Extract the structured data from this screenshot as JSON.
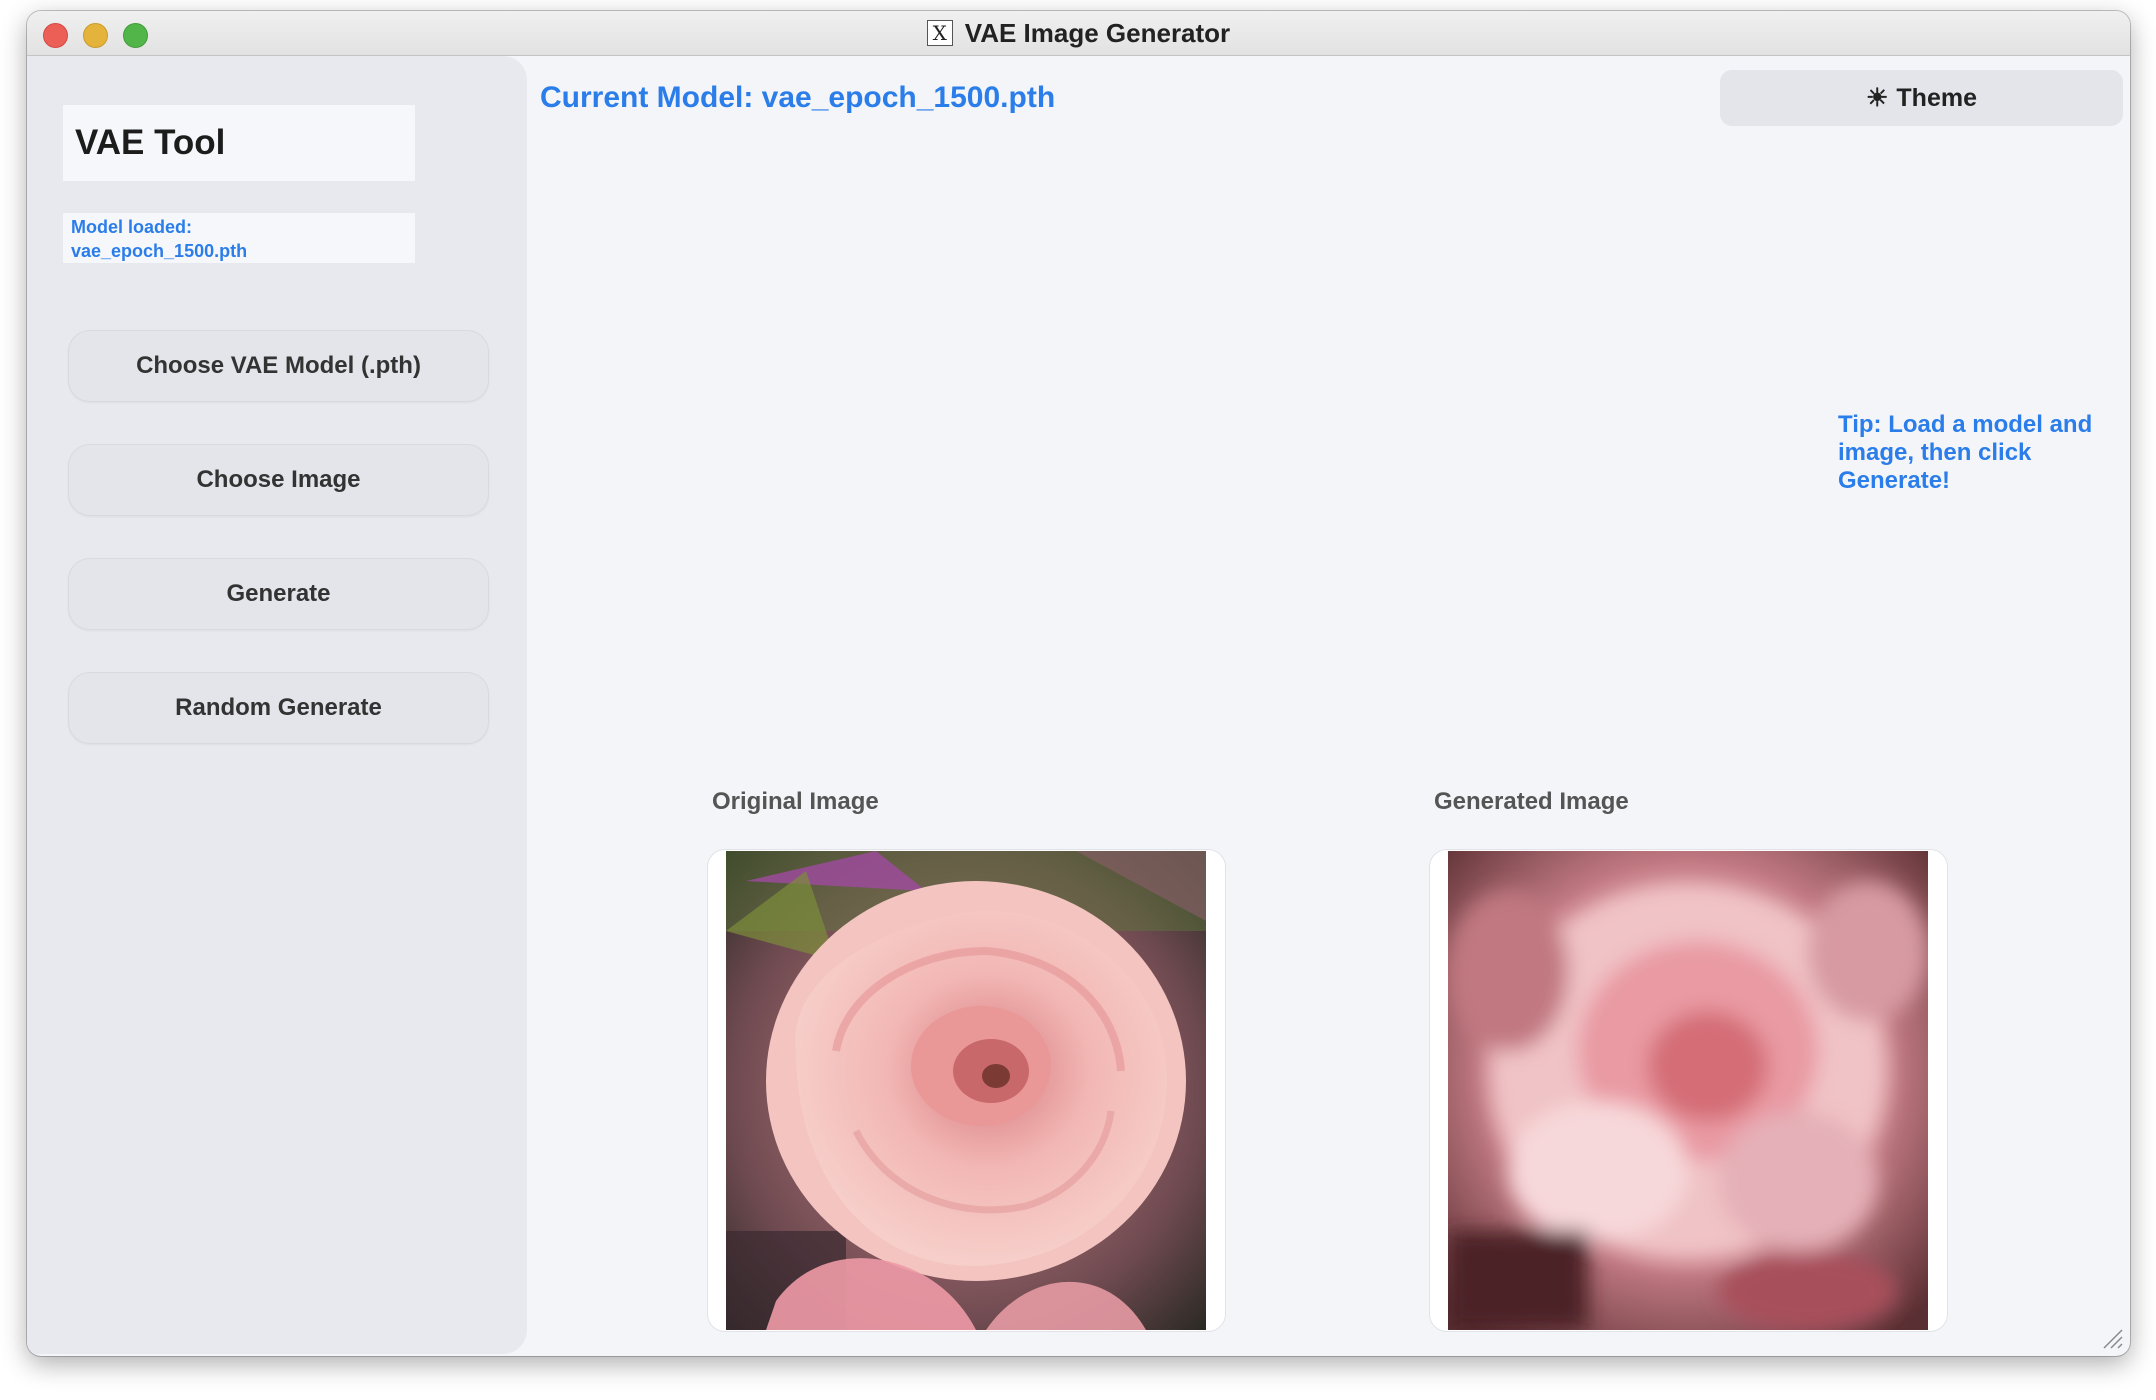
{
  "window": {
    "title": "VAE Image Generator"
  },
  "sidebar": {
    "brand": "VAE Tool",
    "status_line1": "Model loaded:",
    "status_line2": "vae_epoch_1500.pth",
    "buttons": [
      {
        "label": "Choose VAE Model (.pth)"
      },
      {
        "label": "Choose Image"
      },
      {
        "label": "Generate"
      },
      {
        "label": "Random Generate"
      }
    ]
  },
  "main": {
    "current_model": "Current Model: vae_epoch_1500.pth",
    "theme_button": {
      "icon": "sun-icon",
      "label": "Theme"
    },
    "tip": "Tip: Load a model and image, then click Generate!",
    "original_label": "Original Image",
    "generated_label": "Generated Image"
  },
  "colors": {
    "accent": "#2b7de9",
    "sidebar_bg": "#e8e9ee",
    "main_bg": "#f3f5f9",
    "button_bg": "#e4e5ea"
  }
}
